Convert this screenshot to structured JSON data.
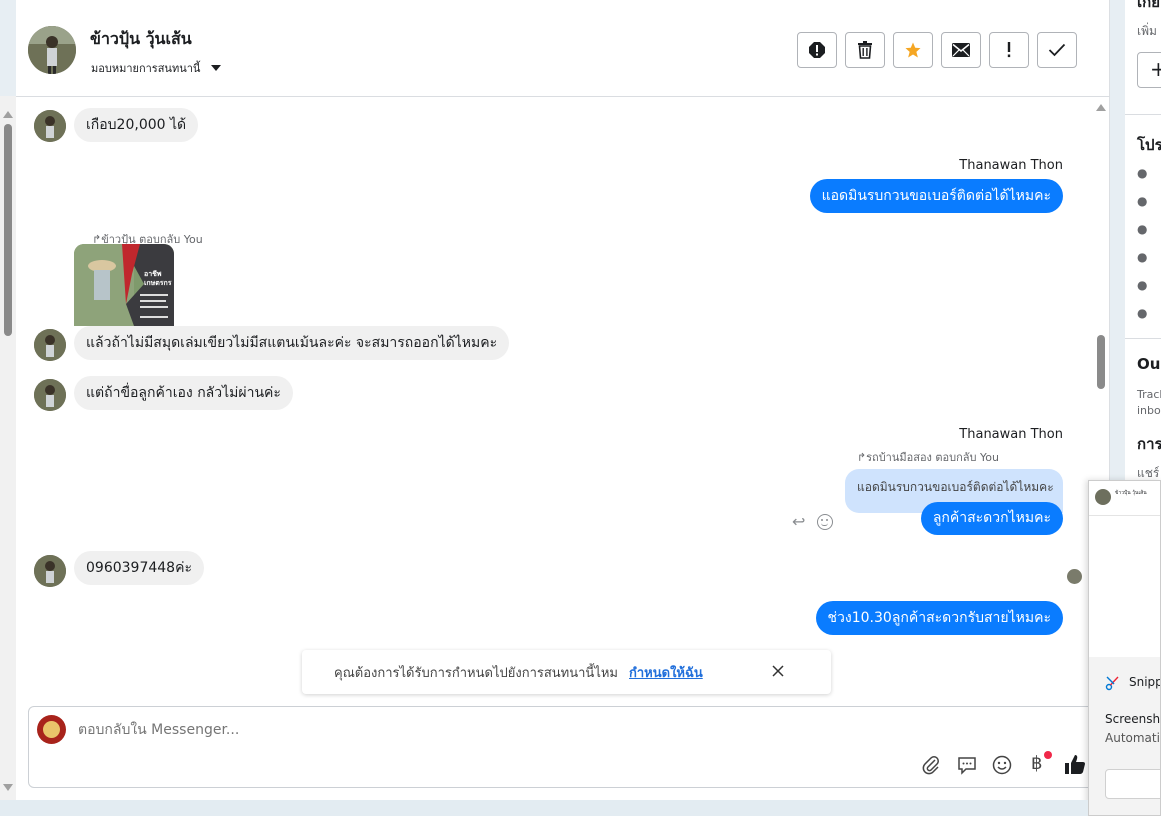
{
  "header": {
    "name": "ข้าวปุ้น วุ้นเส้น",
    "assign_label": "มอบหมายการสนทนานี้"
  },
  "messages": {
    "m1": "เกือบ20,000 ได้",
    "sender1": "Thanawan Thon",
    "m2": "แอดมินรบกวนขอเบอร์ติดต่อได้ไหมคะ",
    "reply_note1": "ข้าวปุ้น ตอบกลับ You",
    "card_title": "อาชีพ เกษตรกร",
    "m3": "แล้วถ้าไม่มีสมุดเล่มเขียวไม่มีสแตนเม้นละค่ะ  จะสมารถออกได้ไหมคะ",
    "m4": "แต่ถ้าขื่อลูกค้าเอง  กลัวไม่ผ่านค่ะ",
    "sender2": "Thanawan Thon",
    "reply_note2": "รถบ้านมือสอง ตอบกลับ You",
    "quoted": "แอดมินรบกวนขอเบอร์ติดต่อได้ไหมคะ",
    "m5": "ลูกค้าสะดวกไหมคะ",
    "m6": "0960397448ค่ะ",
    "m7": "ช่วง10.30ลูกค้าสะดวกรับสายไหมคะ"
  },
  "banner": {
    "text": "คุณต้องการได้รับการกำหนดไปยังการสนทนานี้ไหม",
    "link": "กำหนดให้ฉัน"
  },
  "composer": {
    "placeholder": "ตอบกลับใน Messenger..."
  },
  "right_panel": {
    "top_text": "เกี่ย",
    "add_text": "เพิ่ม",
    "section1": "โปร",
    "section2": "Ou",
    "track1": "Track",
    "track2": "inbo",
    "section3": "การ",
    "share": "แชร์"
  },
  "popup": {
    "name": "ข้าวปุ้น วุ้นเส้น",
    "app": "Snippi",
    "shot1": "Screensh",
    "shot2": "Automati"
  },
  "colors": {
    "accent": "#0a7cff",
    "star": "#f5a623",
    "link": "#216fdb"
  }
}
